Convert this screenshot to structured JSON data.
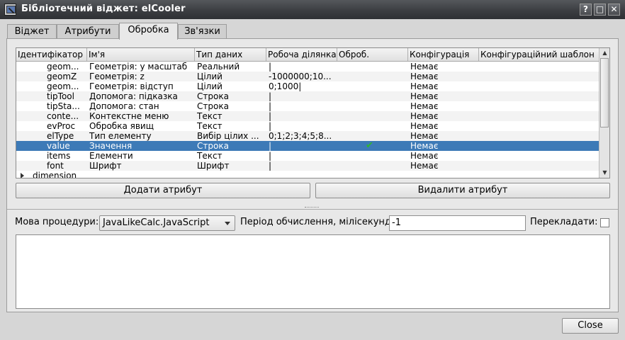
{
  "window": {
    "title": "Бібліотечний віджет: elCooler",
    "help_glyph": "?",
    "maximize_glyph": "□",
    "close_glyph": "✕"
  },
  "tabs": [
    {
      "label": "Віджет"
    },
    {
      "label": "Атрибути"
    },
    {
      "label": "Обробка",
      "active": true
    },
    {
      "label": "Зв'язки"
    }
  ],
  "table": {
    "columns": [
      "Ідентифікатор",
      "Ім'я",
      "Тип даних",
      "Робоча ділянка",
      "Оброб.",
      "Конфігурація",
      "Конфігураційний шаблон"
    ],
    "rows": [
      {
        "id": "geom...",
        "name": "Геометрія: у масштаб",
        "type": "Реальний",
        "work": "|",
        "proc": "",
        "config": "Немає",
        "template": ""
      },
      {
        "id": "geomZ",
        "name": "Геометрія: z",
        "type": "Цілий",
        "work": "-1000000;10...",
        "proc": "",
        "config": "Немає",
        "template": ""
      },
      {
        "id": "geom...",
        "name": "Геометрія: відступ",
        "type": "Цілий",
        "work": "0;1000|",
        "proc": "",
        "config": "Немає",
        "template": ""
      },
      {
        "id": "tipTool",
        "name": "Допомога: підказка",
        "type": "Строка",
        "work": "|",
        "proc": "",
        "config": "Немає",
        "template": ""
      },
      {
        "id": "tipSta...",
        "name": "Допомога: стан",
        "type": "Строка",
        "work": "|",
        "proc": "",
        "config": "Немає",
        "template": ""
      },
      {
        "id": "conte...",
        "name": "Контекстне меню",
        "type": "Текст",
        "work": "|",
        "proc": "",
        "config": "Немає",
        "template": ""
      },
      {
        "id": "evProc",
        "name": "Обробка явищ",
        "type": "Текст",
        "work": "|",
        "proc": "",
        "config": "Немає",
        "template": ""
      },
      {
        "id": "elType",
        "name": "Тип елементу",
        "type": "Вибір цілих ...",
        "work": "0;1;2;3;4;5;8...",
        "proc": "",
        "config": "Немає",
        "template": ""
      },
      {
        "id": "value",
        "name": "Значення",
        "type": "Строка",
        "work": "|",
        "proc": "✔",
        "config": "Немає",
        "template": "",
        "selected": true
      },
      {
        "id": "items",
        "name": "Елементи",
        "type": "Текст",
        "work": "|",
        "proc": "",
        "config": "Немає",
        "template": ""
      },
      {
        "id": "font",
        "name": "Шрифт",
        "type": "Шрифт",
        "work": "|",
        "proc": "",
        "config": "Немає",
        "template": ""
      }
    ],
    "group_row": "dimension"
  },
  "buttons": {
    "add": "Додати атрибут",
    "delete": "Видалити атрибут",
    "close": "Close"
  },
  "procedure": {
    "language_label": "Мова процедури:",
    "language_value": "JavaLikeCalc.JavaScript",
    "period_label": "Період обчислення, мілісекунд:",
    "period_value": "-1",
    "translate_label": "Перекладати:",
    "translate_checked": false
  },
  "colors": {
    "selection": "#3d7ab7",
    "check": "#2fb52f"
  }
}
